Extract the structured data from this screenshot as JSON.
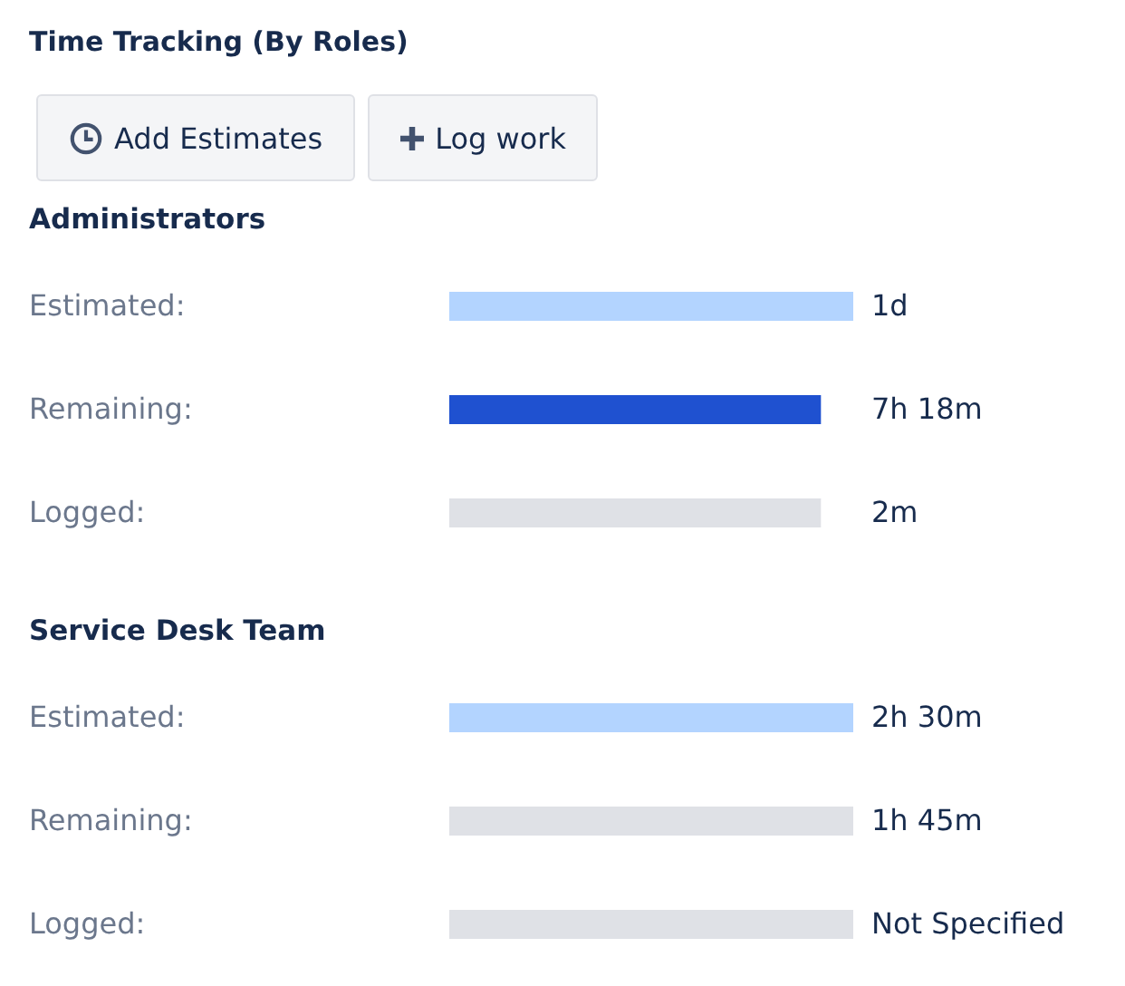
{
  "title": "Time Tracking (By Roles)",
  "buttons": [
    {
      "label": "Add Estimates",
      "kind": "clock"
    },
    {
      "label": "Log work",
      "kind": "plus"
    }
  ],
  "roles": [
    {
      "name": "Administrators",
      "rows": [
        {
          "label": "Estimated:",
          "level": 1,
          "color": "#b3d4ff",
          "value": "1d"
        },
        {
          "label": "Remaining:",
          "level": 0.92,
          "color": "#1f51d0",
          "value": "7h 18m"
        },
        {
          "label": "Logged:",
          "level": 0.92,
          "color": "#dfe1e6",
          "value": "2m"
        }
      ]
    },
    {
      "name": "Service Desk Team",
      "rows": [
        {
          "label": "Estimated:",
          "level": 1,
          "color": "#b3d4ff",
          "value": "2h 30m"
        },
        {
          "label": "Remaining:",
          "level": 1,
          "color": "#dfe1e6",
          "value": "1h 45m"
        },
        {
          "label": "Logged:",
          "level": 1,
          "color": "#dfe1e6",
          "value": "Not Specified"
        }
      ]
    }
  ]
}
